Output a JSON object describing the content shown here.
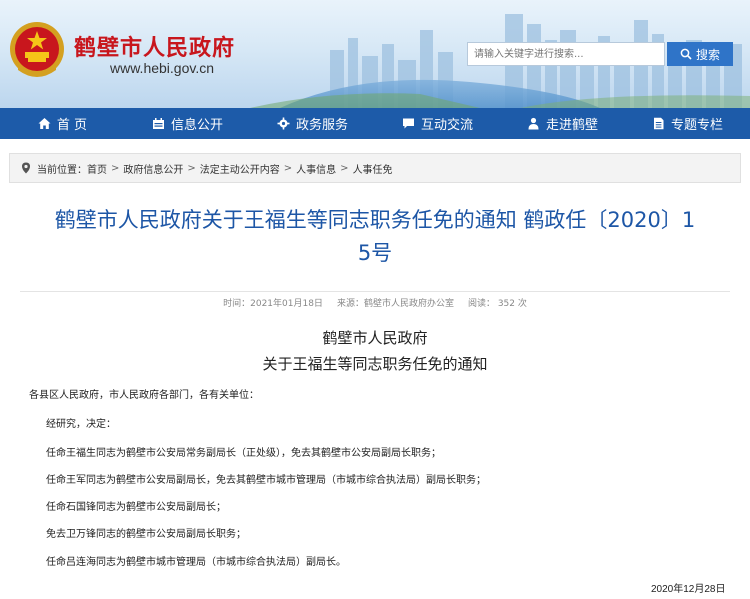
{
  "header": {
    "site_title": "鹤壁市人民政府",
    "site_url": "www.hebi.gov.cn",
    "search_placeholder": "请输入关键字进行搜索...",
    "search_button": "搜索"
  },
  "nav": {
    "items": [
      {
        "label": "首 页",
        "icon": "home-icon"
      },
      {
        "label": "信息公开",
        "icon": "calendar-icon"
      },
      {
        "label": "政务服务",
        "icon": "service-gear-icon"
      },
      {
        "label": "互动交流",
        "icon": "chat-icon"
      },
      {
        "label": "走进鹤壁",
        "icon": "person-icon"
      },
      {
        "label": "专题专栏",
        "icon": "document-icon"
      }
    ]
  },
  "breadcrumb": {
    "prefix": "当前位置：",
    "items": [
      "首页",
      "政府信息公开",
      "法定主动公开内容",
      "人事信息",
      "人事任免"
    ],
    "separator": ">"
  },
  "article": {
    "title_line1": "鹤壁市人民政府关于王福生等同志职务任免的通知 鹤政任〔2020〕1",
    "title_line2": "5号",
    "meta_time": "时间：2021年01月18日",
    "meta_source": "来源：鹤壁市人民政府办公室",
    "meta_views": "阅读： 352 次",
    "doc_org": "鹤壁市人民政府",
    "doc_heading": "关于王福生等同志职务任免的通知",
    "salutation": "各县区人民政府，市人民政府各部门，各有关单位：",
    "paragraphs": [
      "经研究，决定：",
      "任命王福生同志为鹤壁市公安局常务副局长（正处级），免去其鹤壁市公安局副局长职务；",
      "任命王军同志为鹤壁市公安局副局长，免去其鹤壁市城市管理局（市城市综合执法局）副局长职务；",
      "任命石国锋同志为鹤壁市公安局副局长；",
      "免去卫万锋同志的鹤壁市公安局副局长职务；",
      "任命吕连海同志为鹤壁市城市管理局（市城市综合执法局）副局长。"
    ],
    "date": "2020年12月28日"
  },
  "colors": {
    "brand_red": "#c8161d",
    "nav_blue": "#1d5ba9",
    "title_blue": "#1d56a6",
    "search_blue": "#2f74c8"
  }
}
